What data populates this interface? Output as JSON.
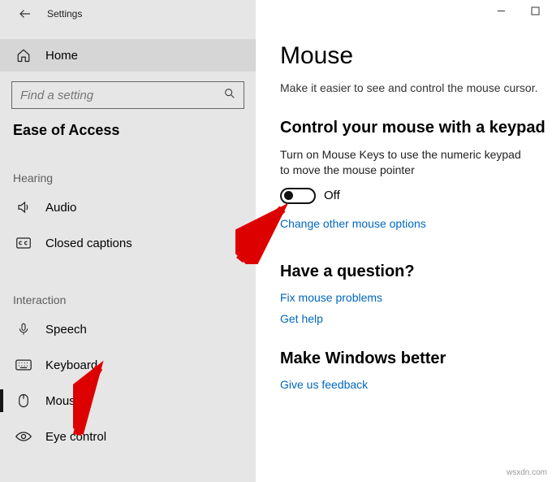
{
  "titlebar": {
    "label": "Settings"
  },
  "home": {
    "label": "Home"
  },
  "search": {
    "placeholder": "Find a setting"
  },
  "category": "Ease of Access",
  "groups": {
    "hearing": {
      "label": "Hearing",
      "items": [
        {
          "icon": "audio",
          "label": "Audio"
        },
        {
          "icon": "cc",
          "label": "Closed captions"
        }
      ]
    },
    "interaction": {
      "label": "Interaction",
      "items": [
        {
          "icon": "speech",
          "label": "Speech"
        },
        {
          "icon": "keyboard",
          "label": "Keyboard"
        },
        {
          "icon": "mouse",
          "label": "Mouse"
        },
        {
          "icon": "eye",
          "label": "Eye control"
        }
      ]
    }
  },
  "page": {
    "title": "Mouse",
    "subtitle": "Make it easier to see and control the mouse cursor.",
    "section1_head": "Control your mouse with a keypad",
    "section1_desc": "Turn on Mouse Keys to use the numeric keypad to move the mouse pointer",
    "toggle_state": "Off",
    "link_other": "Change other mouse options",
    "section2_head": "Have a question?",
    "link_fix": "Fix mouse problems",
    "link_help": "Get help",
    "section3_head": "Make Windows better",
    "link_feedback": "Give us feedback"
  },
  "watermark": "wsxdn.com"
}
